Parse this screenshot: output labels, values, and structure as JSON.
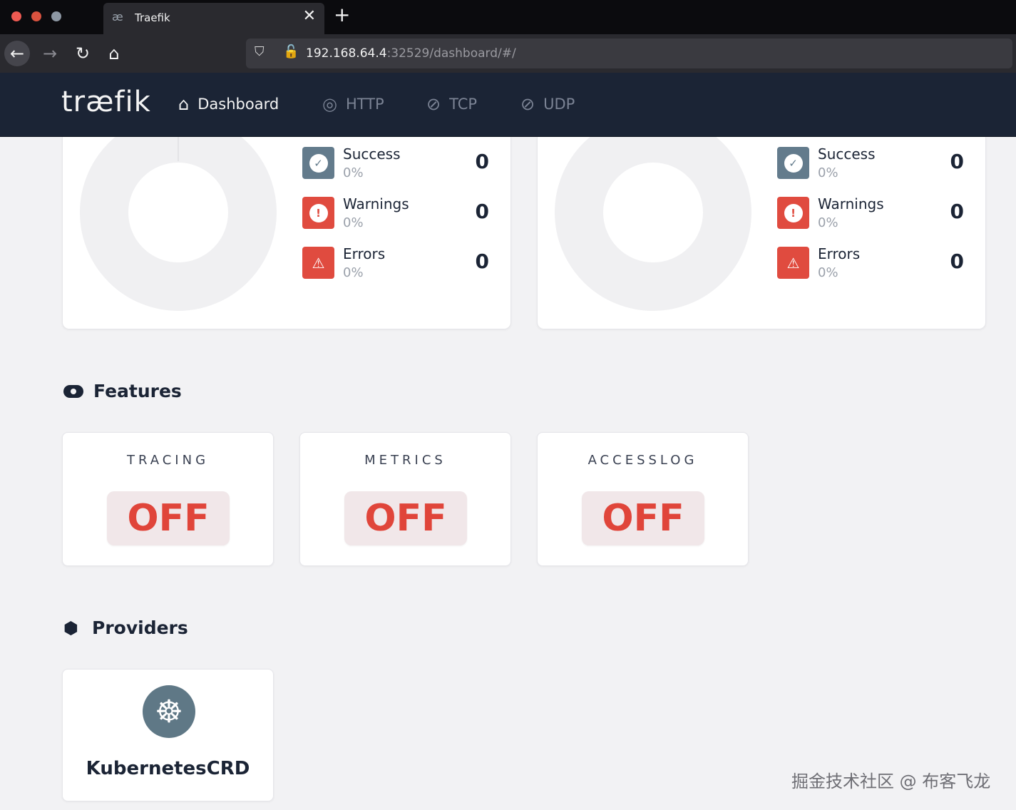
{
  "browser": {
    "tab_title": "Traefik",
    "tab_close": "✕",
    "new_tab": "+",
    "url_host": "192.168.64.4",
    "url_rest": ":32529/dashboard/#/"
  },
  "header": {
    "logo": "træfik",
    "menu": [
      {
        "label": "Dashboard",
        "icon": "home-icon",
        "active": true
      },
      {
        "label": "HTTP",
        "icon": "globe-icon",
        "active": false
      },
      {
        "label": "TCP",
        "icon": "tcp-icon",
        "active": false
      },
      {
        "label": "UDP",
        "icon": "udp-icon",
        "active": false
      }
    ]
  },
  "stats": [
    {
      "success": {
        "label": "Success",
        "pct": "0%",
        "value": "0"
      },
      "warnings": {
        "label": "Warnings",
        "pct": "0%",
        "value": "0"
      },
      "errors": {
        "label": "Errors",
        "pct": "0%",
        "value": "0"
      }
    },
    {
      "success": {
        "label": "Success",
        "pct": "0%",
        "value": "0"
      },
      "warnings": {
        "label": "Warnings",
        "pct": "0%",
        "value": "0"
      },
      "errors": {
        "label": "Errors",
        "pct": "0%",
        "value": "0"
      }
    }
  ],
  "features": {
    "title": "Features",
    "items": [
      {
        "name": "TRACING",
        "status": "OFF"
      },
      {
        "name": "METRICS",
        "status": "OFF"
      },
      {
        "name": "ACCESSLOG",
        "status": "OFF"
      }
    ]
  },
  "providers": {
    "title": "Providers",
    "items": [
      {
        "name": "KubernetesCRD",
        "icon": "kubernetes-icon"
      }
    ]
  },
  "watermark": "掘金技术社区 @ 布客飞龙",
  "colors": {
    "header_bg": "#1b2435",
    "status_off": "#e0453a",
    "success_icon": "#637b8c",
    "error_icon": "#e04b3f"
  }
}
